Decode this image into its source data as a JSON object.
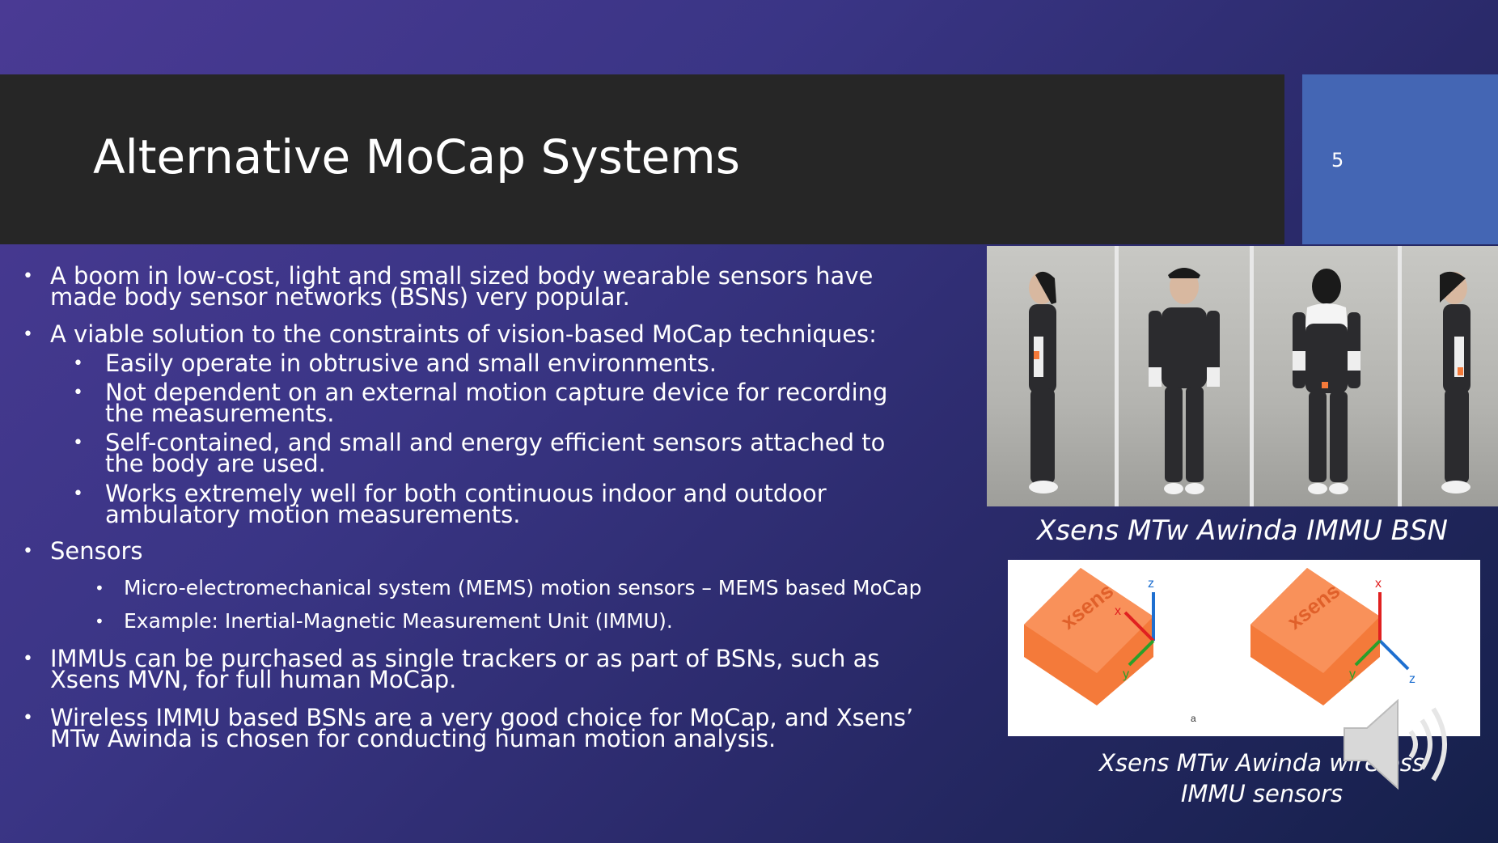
{
  "slide": {
    "title": "Alternative MoCap Systems",
    "number": "5"
  },
  "bullets": [
    {
      "level": 1,
      "text": "A boom in low-cost, light and small sized body wearable sensors have made body sensor networks (BSNs) very popular."
    },
    {
      "level": 1,
      "text": "A viable solution to the constraints of vision-based MoCap techniques:"
    },
    {
      "level": 2,
      "text": "Easily operate in obtrusive and small environments."
    },
    {
      "level": 2,
      "text": "Not dependent on an external motion capture device for recording the measurements."
    },
    {
      "level": 2,
      "text": "Self-contained, and  small and energy efficient sensors attached to the body are used."
    },
    {
      "level": 2,
      "text": "Works extremely well for both continuous indoor and outdoor ambulatory motion measurements."
    },
    {
      "level": 1,
      "text": "Sensors"
    },
    {
      "level": 3,
      "text": "Micro-electromechanical system (MEMS) motion sensors – MEMS based MoCap"
    },
    {
      "level": 3,
      "text": "Example: Inertial-Magnetic Measurement Unit (IMMU)."
    },
    {
      "level": 1,
      "text": "IMMUs can be purchased as single trackers or as part of BSNs, such as Xsens MVN, for full human MoCap."
    },
    {
      "level": 1,
      "text": "Wireless IMMU based BSNs are a very good choice for MoCap, and Xsens’ MTw Awinda is chosen for conducting human motion analysis."
    }
  ],
  "figures": {
    "bsn_caption": "Xsens MTw Awinda IMMU BSN",
    "sensors_caption": "Xsens MTw Awinda wireless IMMU sensors",
    "sensor_brand": "xsens",
    "sensor_axes": [
      "x",
      "y",
      "z"
    ],
    "sensor_sublabel": "a"
  },
  "colors": {
    "title_bar": "#262626",
    "number_box": "#4466b4",
    "sensor_orange": "#f47a3a"
  },
  "icons": {
    "bullet": "•",
    "audio": "speaker-icon"
  }
}
